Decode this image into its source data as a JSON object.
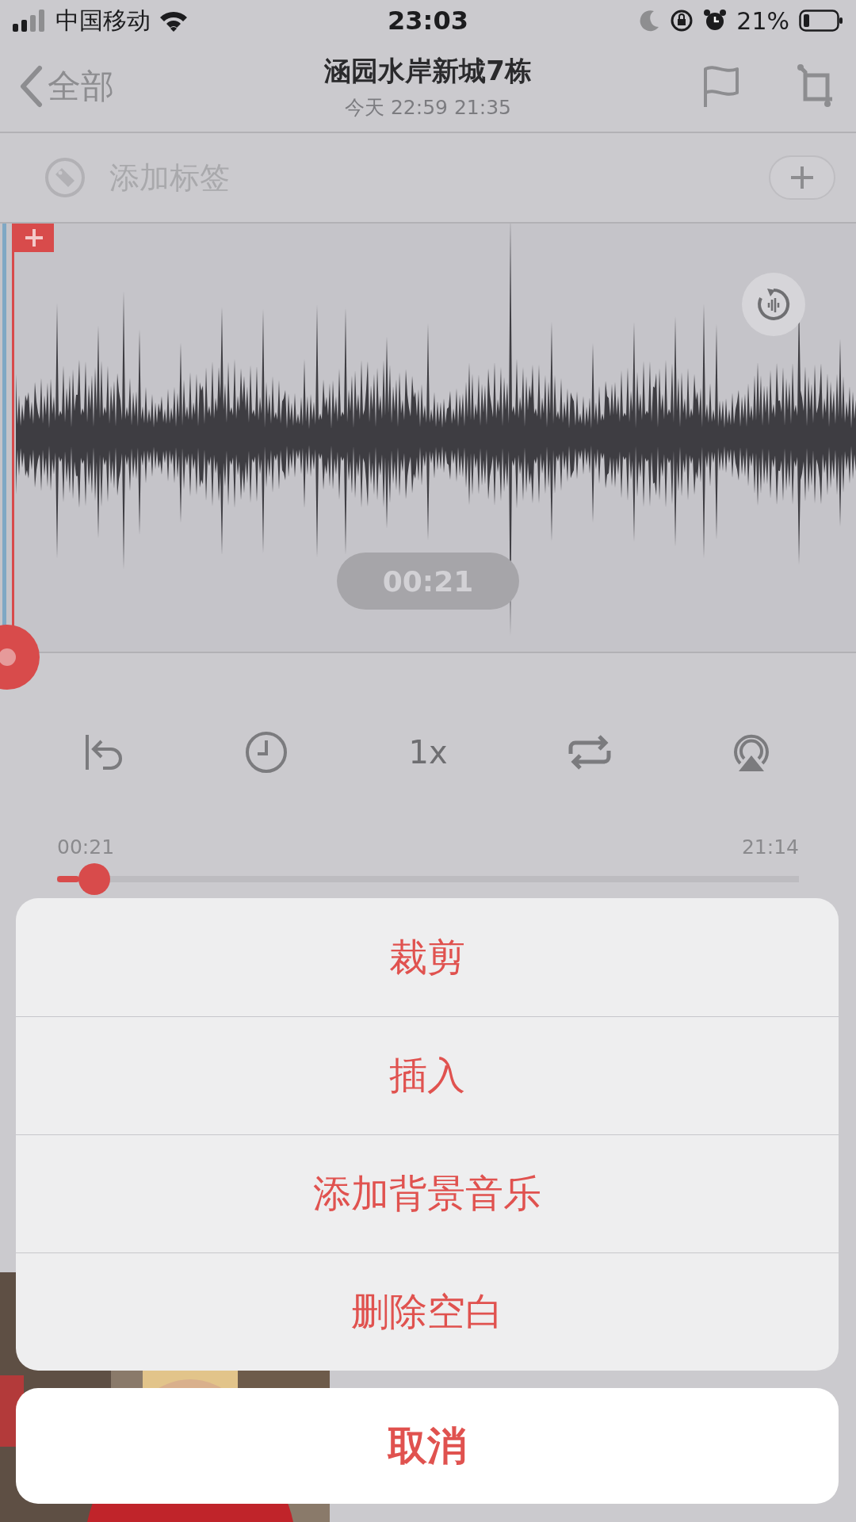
{
  "status_bar": {
    "carrier": "中国移动",
    "time": "23:03",
    "battery": "21%"
  },
  "nav": {
    "back": "全部",
    "title": "涵园水岸新城7栋",
    "subtitle": "今天 22:59 21:35"
  },
  "tags": {
    "placeholder": "添加标签"
  },
  "waveform": {
    "time": "00:21"
  },
  "controls": {
    "speed": "1x"
  },
  "progress": {
    "elapsed": "00:21",
    "total": "21:14",
    "level": 0.03
  },
  "action_sheet": {
    "actions": [
      "裁剪",
      "插入",
      "添加背景音乐",
      "删除空白"
    ],
    "cancel": "取消"
  }
}
